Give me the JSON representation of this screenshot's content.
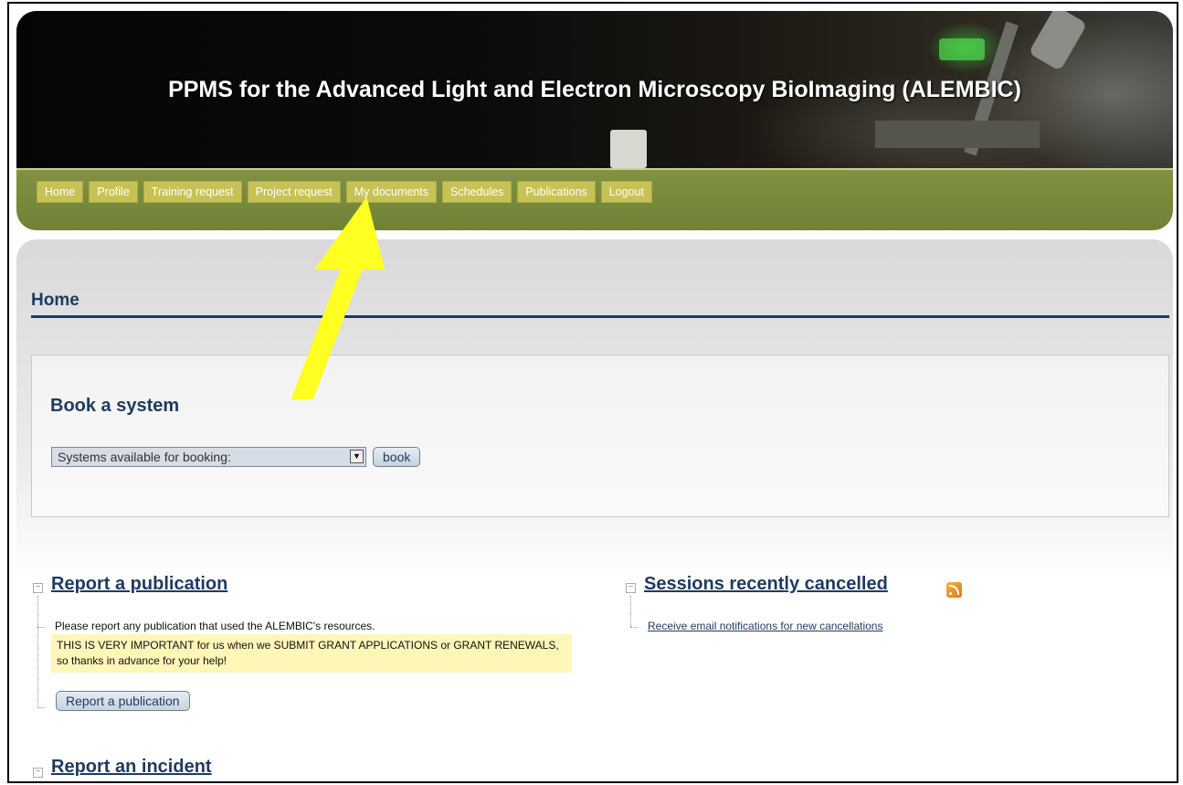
{
  "header": {
    "title": "PPMS for the Advanced Light and Electron Microscopy BioImaging (ALEMBIC)"
  },
  "nav": {
    "items": [
      "Home",
      "Profile",
      "Training request",
      "Project request",
      "My documents",
      "Schedules",
      "Publications",
      "Logout"
    ]
  },
  "page": {
    "title": "Home"
  },
  "booking": {
    "title": "Book a system",
    "select_value": "Systems available for booking:",
    "book_label": "book"
  },
  "publication": {
    "title": "Report a publication",
    "description": "Please report any publication that used the ALEMBIC's resources.",
    "note": "THIS IS VERY IMPORTANT for us when we SUBMIT GRANT APPLICATIONS or GRANT RENEWALS, so thanks in advance for your help!",
    "button_label": "Report a publication"
  },
  "cancellations": {
    "title": "Sessions recently cancelled",
    "link": "Receive email notifications for new cancellations"
  },
  "incident": {
    "title": "Report an incident"
  },
  "colors": {
    "nav_bg": "#c6c255",
    "heading": "#1f3a5f",
    "note_bg": "#fff6b8",
    "annotation_arrow": "#ffff22"
  },
  "icons": {
    "rss": "rss-icon",
    "collapse": "minus-box-icon",
    "dropdown": "triangle-down-icon"
  }
}
